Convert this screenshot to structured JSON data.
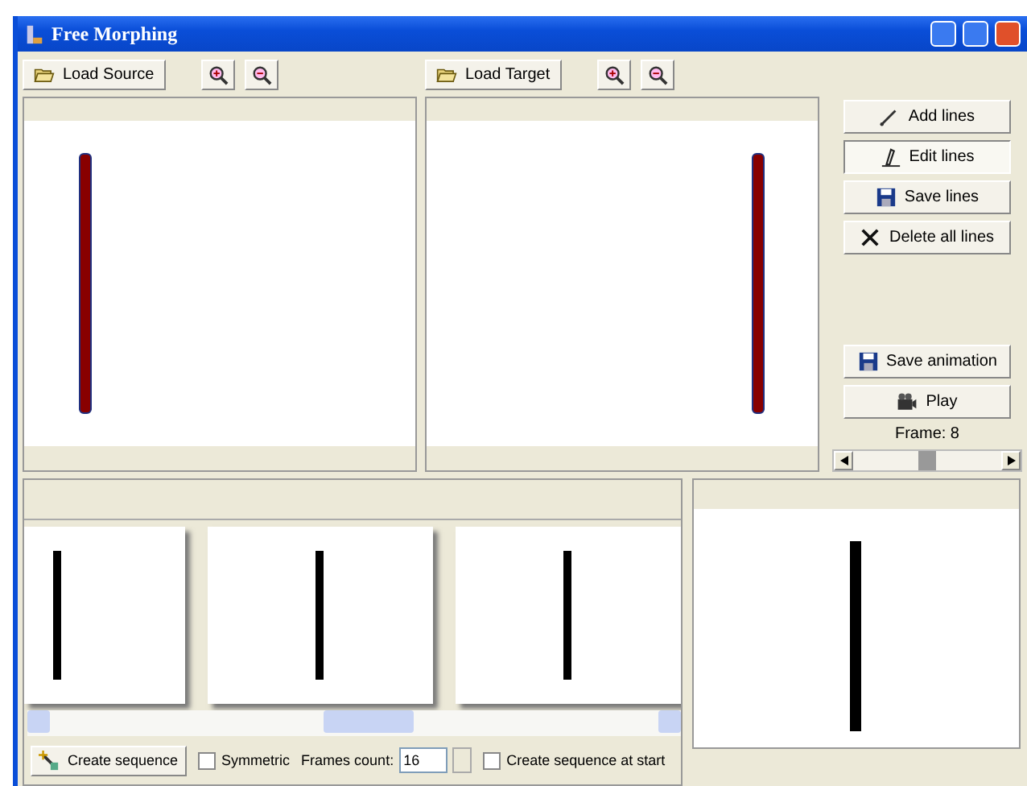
{
  "window": {
    "title": "Free Morphing"
  },
  "source_toolbar": {
    "load_button": "Load Source"
  },
  "target_toolbar": {
    "load_button": "Load Target"
  },
  "line_tools": [
    {
      "label": "Add lines",
      "selected": false
    },
    {
      "label": "Edit lines",
      "selected": true
    },
    {
      "label": "Save lines",
      "selected": false
    },
    {
      "label": "Delete all lines",
      "selected": false
    }
  ],
  "animation_tools": [
    {
      "label": "Save animation"
    },
    {
      "label": "Play"
    }
  ],
  "frame": {
    "label": "Frame: 8",
    "level": 0.5
  },
  "sequence_toolbar": {
    "create_button": "Create sequence",
    "options": [
      {
        "kind": "checkbox",
        "label": "Symmetric",
        "checked": false
      },
      {
        "kind": "spinner",
        "label": "Frames count:",
        "value": "16"
      },
      {
        "kind": "checkbox",
        "label": "Create sequence at start",
        "checked": false
      }
    ]
  }
}
